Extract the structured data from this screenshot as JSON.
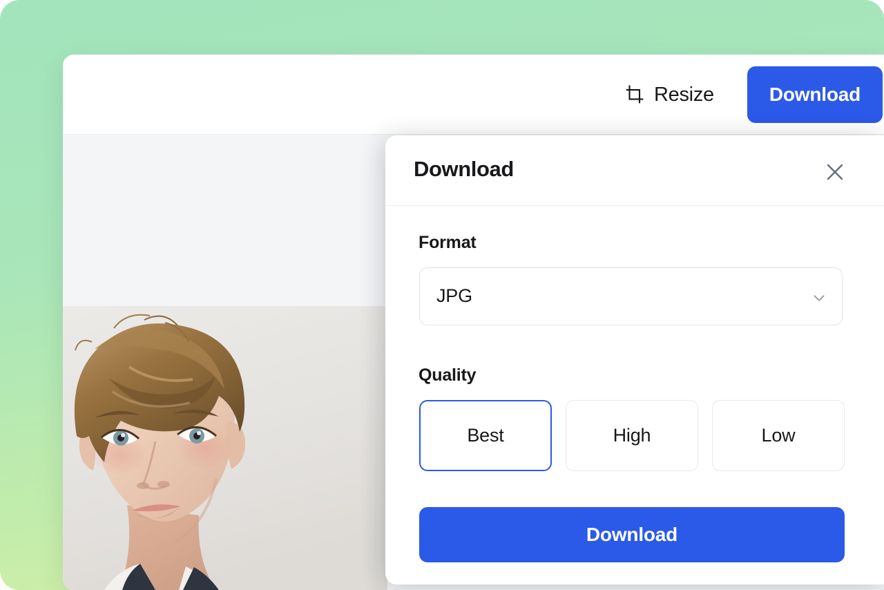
{
  "theme": {
    "accent_blue": "#2b59e8",
    "gradient_top": "#a3e4bc",
    "gradient_bottom": "#dcf2a5",
    "canvas_bg": "#f4f5f7"
  },
  "toolbar": {
    "resize_label": "Resize",
    "resize_icon": "crop-icon",
    "download_label": "Download"
  },
  "canvas": {
    "photo_alt": "portrait-photo"
  },
  "modal": {
    "title": "Download",
    "close_icon": "close-icon",
    "format": {
      "label": "Format",
      "value": "JPG",
      "chevron_icon": "chevron-down-icon"
    },
    "quality": {
      "label": "Quality",
      "options": [
        {
          "label": "Best",
          "selected": true
        },
        {
          "label": "High",
          "selected": false
        },
        {
          "label": "Low",
          "selected": false
        }
      ]
    },
    "submit_label": "Download"
  }
}
